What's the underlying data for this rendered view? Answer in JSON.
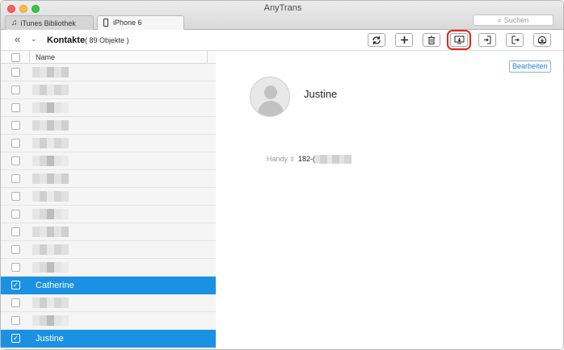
{
  "window": {
    "title": "AnyTrans"
  },
  "tabs": [
    {
      "label": "iTunes Bibliothek",
      "icon": "music-note-icon"
    },
    {
      "label": "iPhone 6",
      "icon": "iphone-icon"
    }
  ],
  "search": {
    "placeholder": "Suchen"
  },
  "toolbar": {
    "view_title": "Kontakte",
    "count": "( 89 Objekte )",
    "buttons": [
      {
        "name": "refresh",
        "icon": "refresh-icon"
      },
      {
        "name": "add",
        "icon": "plus-icon"
      },
      {
        "name": "delete",
        "icon": "trash-icon"
      },
      {
        "name": "transfer-to-computer",
        "icon": "to-computer-icon",
        "highlighted": true
      },
      {
        "name": "import",
        "icon": "import-icon"
      },
      {
        "name": "export",
        "icon": "export-icon"
      },
      {
        "name": "send-to-device",
        "icon": "to-device-icon"
      }
    ]
  },
  "list": {
    "header": "Name",
    "rows": [
      {
        "name": "",
        "checked": false,
        "selected": false
      },
      {
        "name": "",
        "checked": false,
        "selected": false
      },
      {
        "name": "",
        "checked": false,
        "selected": false
      },
      {
        "name": "",
        "checked": false,
        "selected": false
      },
      {
        "name": "",
        "checked": false,
        "selected": false
      },
      {
        "name": "",
        "checked": false,
        "selected": false
      },
      {
        "name": "",
        "checked": false,
        "selected": false
      },
      {
        "name": "",
        "checked": false,
        "selected": false
      },
      {
        "name": "",
        "checked": false,
        "selected": false
      },
      {
        "name": "",
        "checked": false,
        "selected": false
      },
      {
        "name": "",
        "checked": false,
        "selected": false
      },
      {
        "name": "",
        "checked": false,
        "selected": false
      },
      {
        "name": "Catherine",
        "checked": true,
        "selected": true
      },
      {
        "name": "",
        "checked": false,
        "selected": false
      },
      {
        "name": "",
        "checked": false,
        "selected": false
      },
      {
        "name": "Justine",
        "checked": true,
        "selected": true
      }
    ]
  },
  "detail": {
    "edit_label": "Bearbeiten",
    "contact_name": "Justine",
    "phone_label": "Handy",
    "phone_value": "182-("
  },
  "colors": {
    "selection": "#1a91e2",
    "highlight_outline": "#e0261b",
    "edit_accent": "#2d7fc8"
  }
}
